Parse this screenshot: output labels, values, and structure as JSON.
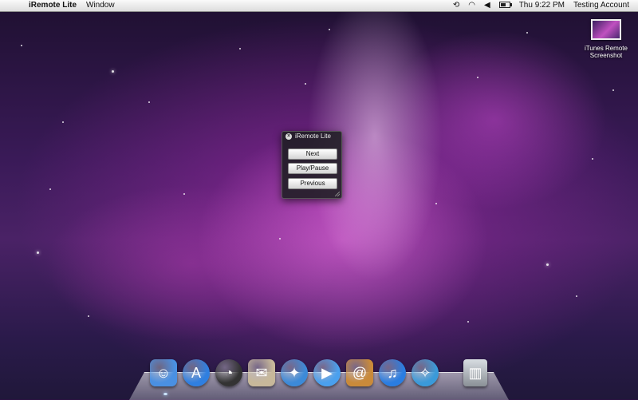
{
  "menubar": {
    "app_name": "iRemote Lite",
    "menus": [
      "Window"
    ],
    "clock": "Thu 9:22 PM",
    "user": "Testing Account",
    "battery_level": 0.6
  },
  "desktop": {
    "files": [
      {
        "name_line1": "iTunes Remote",
        "name_line2": "Screenshot"
      }
    ]
  },
  "panel": {
    "title": "iRemote Lite",
    "buttons": {
      "next": "Next",
      "play_pause": "Play/Pause",
      "previous": "Previous"
    }
  },
  "dock": {
    "icons": [
      {
        "name": "finder-icon",
        "color": "#4a90e2"
      },
      {
        "name": "app-store-icon",
        "color": "#2f7fe0"
      },
      {
        "name": "dashboard-icon",
        "color": "#333333"
      },
      {
        "name": "mail-icon",
        "color": "#c7b89a"
      },
      {
        "name": "safari-icon",
        "color": "#3c8ad8"
      },
      {
        "name": "ichat-icon",
        "color": "#4aa0ee"
      },
      {
        "name": "address-book-icon",
        "color": "#c98a3a"
      },
      {
        "name": "itunes-icon",
        "color": "#2a7de1"
      },
      {
        "name": "ilife-icon",
        "color": "#3a9ad9"
      },
      {
        "name": "trash-icon",
        "color": "#9aa0a6"
      }
    ]
  }
}
